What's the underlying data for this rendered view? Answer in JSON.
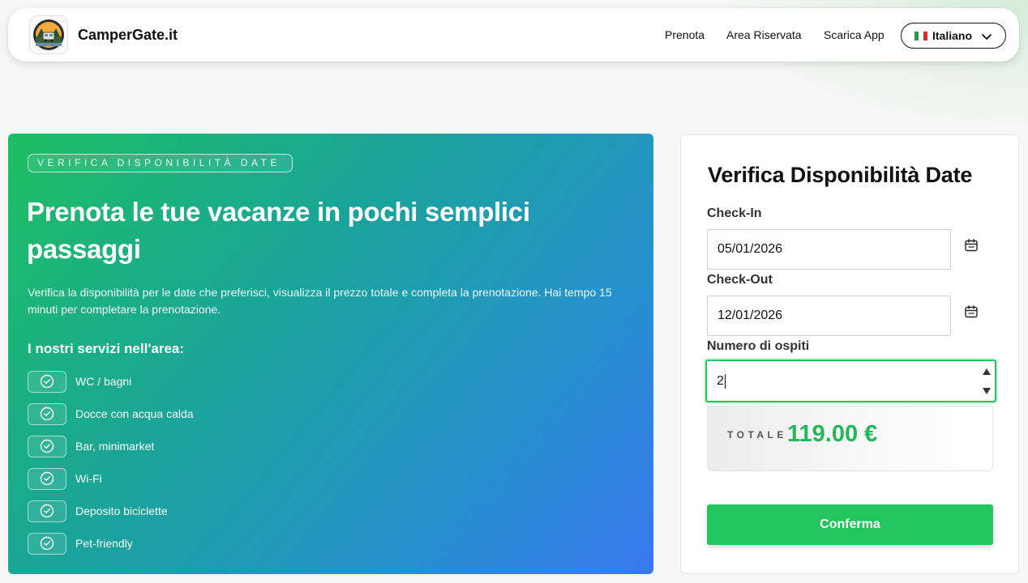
{
  "header": {
    "brand": "CamperGate.it",
    "nav": [
      "Prenota",
      "Area Riservata",
      "Scarica App"
    ],
    "language": "Italiano"
  },
  "hero": {
    "badge": "VERIFICA DISPONIBILITÀ DATE",
    "title": "Prenota le tue vacanze in pochi semplici passaggi",
    "description": "Verifica la disponibilità per le date che preferisci, visualizza il prezzo totale e completa la prenotazione. Hai tempo 15 minuti per completare la prenotazione.",
    "services_title": "I nostri servizi nell'area:",
    "services": [
      "WC / bagni",
      "Docce con acqua calda",
      "Bar, minimarket",
      "Wi-Fi",
      "Deposito biciclette",
      "Pet-friendly"
    ]
  },
  "form": {
    "title": "Verifica Disponibilità Date",
    "checkin_label": "Check-In",
    "checkin_value": "05/01/2026",
    "checkout_label": "Check-Out",
    "checkout_value": "12/01/2026",
    "guests_label": "Numero di ospiti",
    "guests_value": "2",
    "total_label": "TOTALE",
    "total_value": "119.00 €",
    "confirm_label": "Conferma"
  },
  "colors": {
    "accent_green": "#22c55e",
    "hero_gradient_start": "#1fbf62",
    "hero_gradient_end": "#3a78f0"
  },
  "icons": [
    "logo-icon",
    "italy-flag-icon",
    "chevron-down-icon",
    "check-circle-icon",
    "calendar-icon",
    "spinner-arrows-icon"
  ]
}
